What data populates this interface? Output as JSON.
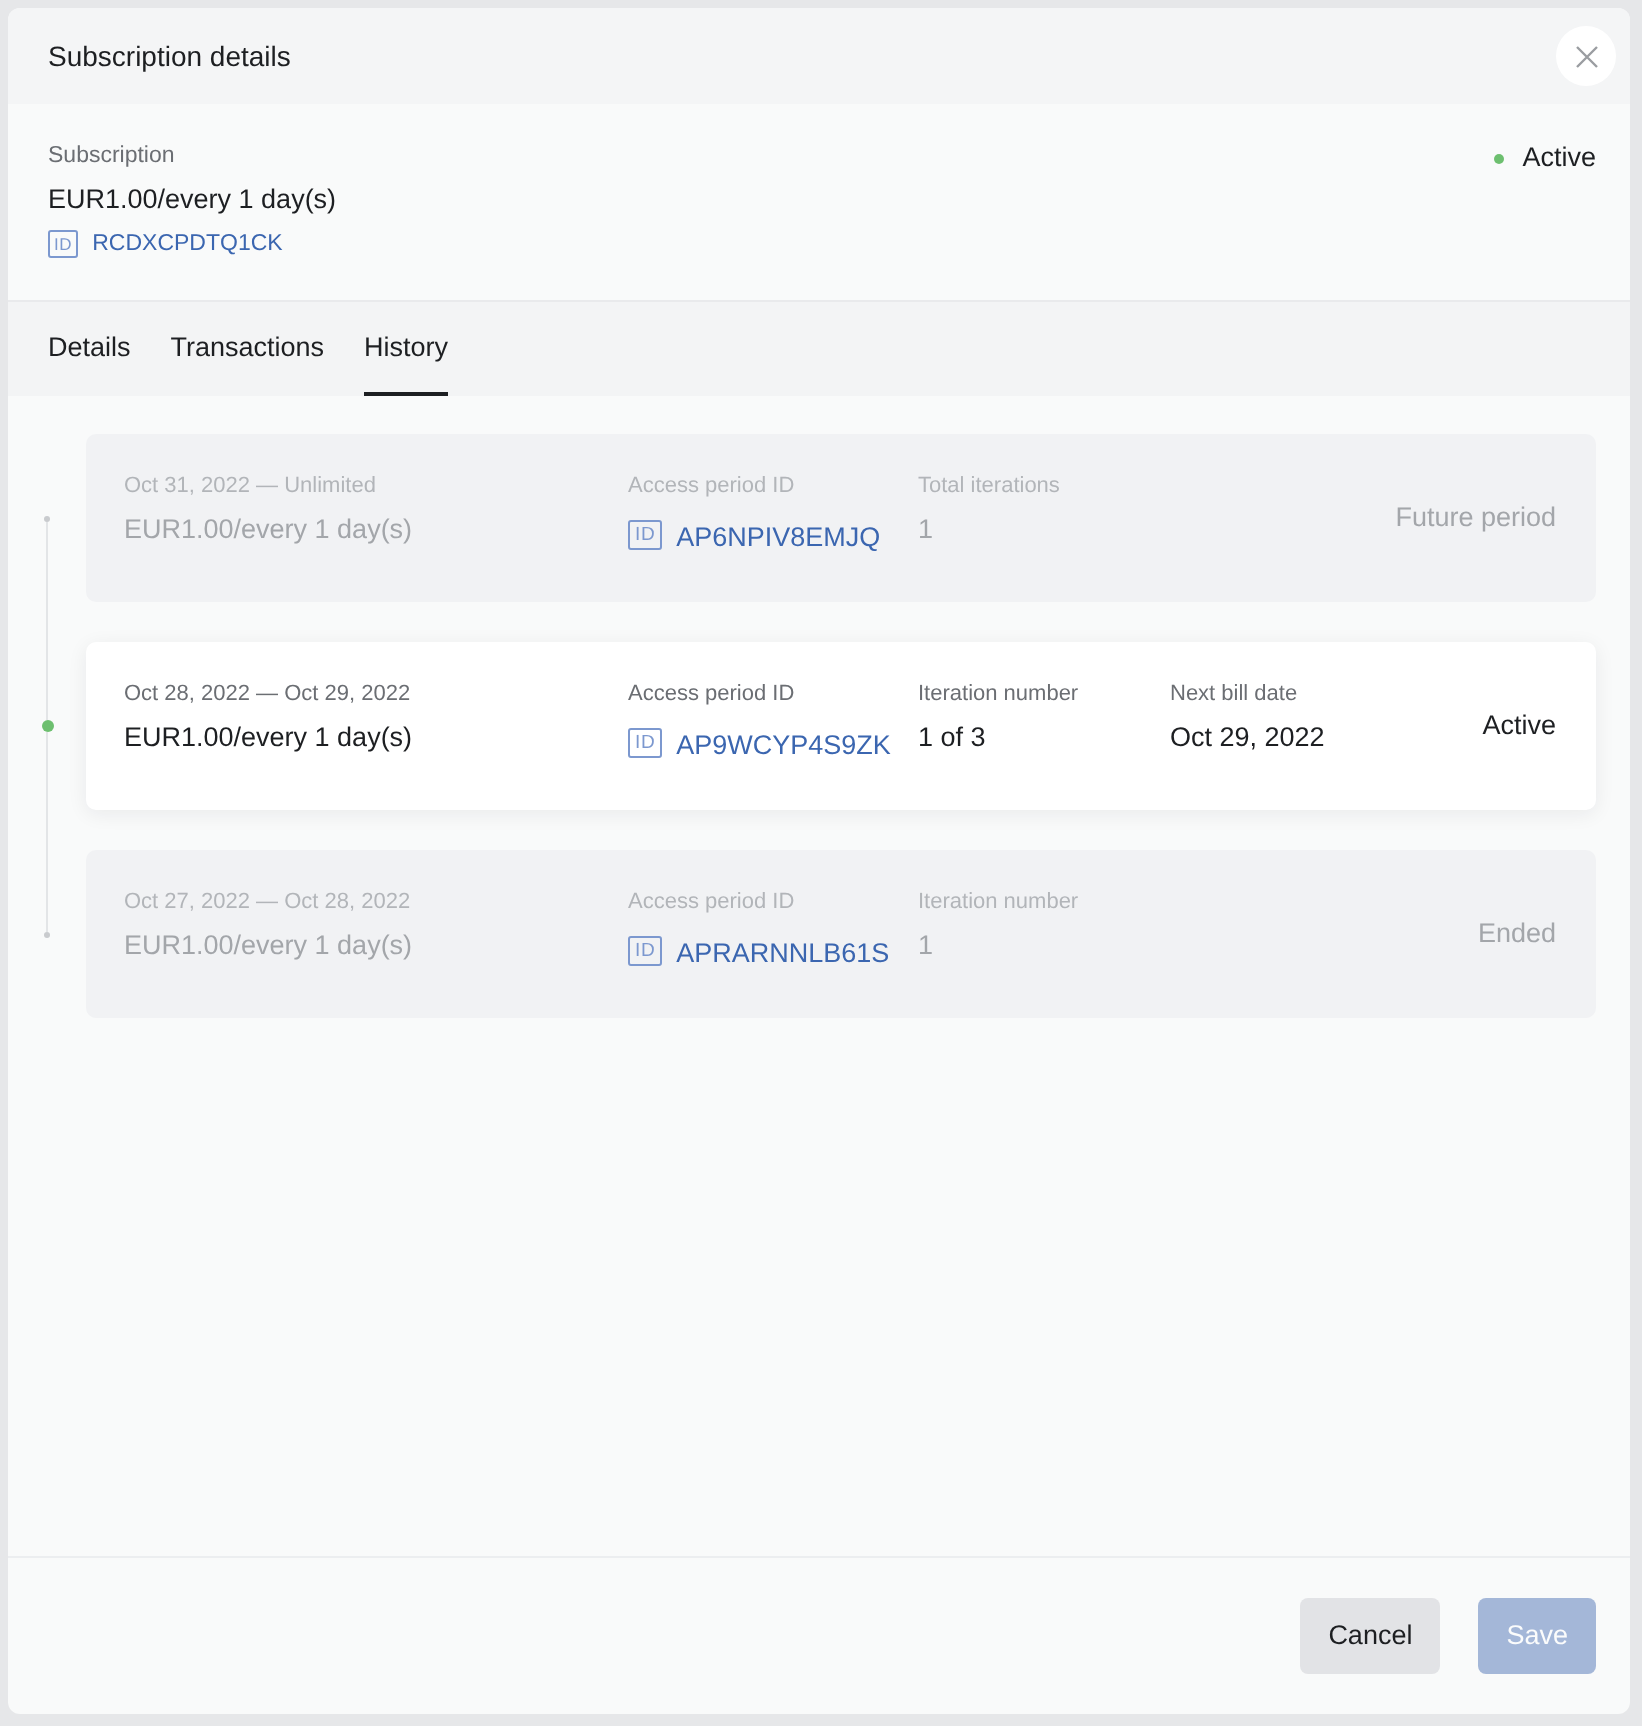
{
  "dialog": {
    "title": "Subscription details"
  },
  "subscription": {
    "label": "Subscription",
    "price": "EUR1.00/every 1 day(s)",
    "id_tag": "ID",
    "id": "RCDXCPDTQ1CK",
    "status": "Active"
  },
  "tabs": [
    {
      "label": "Details",
      "selected": false
    },
    {
      "label": "Transactions",
      "selected": false
    },
    {
      "label": "History",
      "selected": true
    }
  ],
  "periods": [
    {
      "current": false,
      "date_range": "Oct 31, 2022 — Unlimited",
      "price": "EUR1.00/every 1 day(s)",
      "fields": [
        {
          "kind": "id",
          "label": "Access period ID",
          "id_tag": "ID",
          "value": "AP6NPIV8EMJQ"
        },
        {
          "kind": "text",
          "label": "Total iterations",
          "value": "1"
        }
      ],
      "status": "Future period"
    },
    {
      "current": true,
      "date_range": "Oct 28, 2022 — Oct 29, 2022",
      "price": "EUR1.00/every 1 day(s)",
      "fields": [
        {
          "kind": "id",
          "label": "Access period ID",
          "id_tag": "ID",
          "value": "AP9WCYP4S9ZK"
        },
        {
          "kind": "text",
          "label": "Iteration number",
          "value": "1 of 3"
        },
        {
          "kind": "text",
          "label": "Next bill date",
          "value": "Oct 29, 2022"
        }
      ],
      "status": "Active"
    },
    {
      "current": false,
      "date_range": "Oct 27, 2022 — Oct 28, 2022",
      "price": "EUR1.00/every 1 day(s)",
      "fields": [
        {
          "kind": "id",
          "label": "Access period ID",
          "id_tag": "ID",
          "value": "APRARNNLB61S"
        },
        {
          "kind": "text",
          "label": "Iteration number",
          "value": "1"
        }
      ],
      "status": "Ended"
    }
  ],
  "buttons": [
    {
      "kind": "secondary",
      "label": "Cancel",
      "disabled": false
    },
    {
      "kind": "primary",
      "label": "Save",
      "disabled": true
    }
  ]
}
